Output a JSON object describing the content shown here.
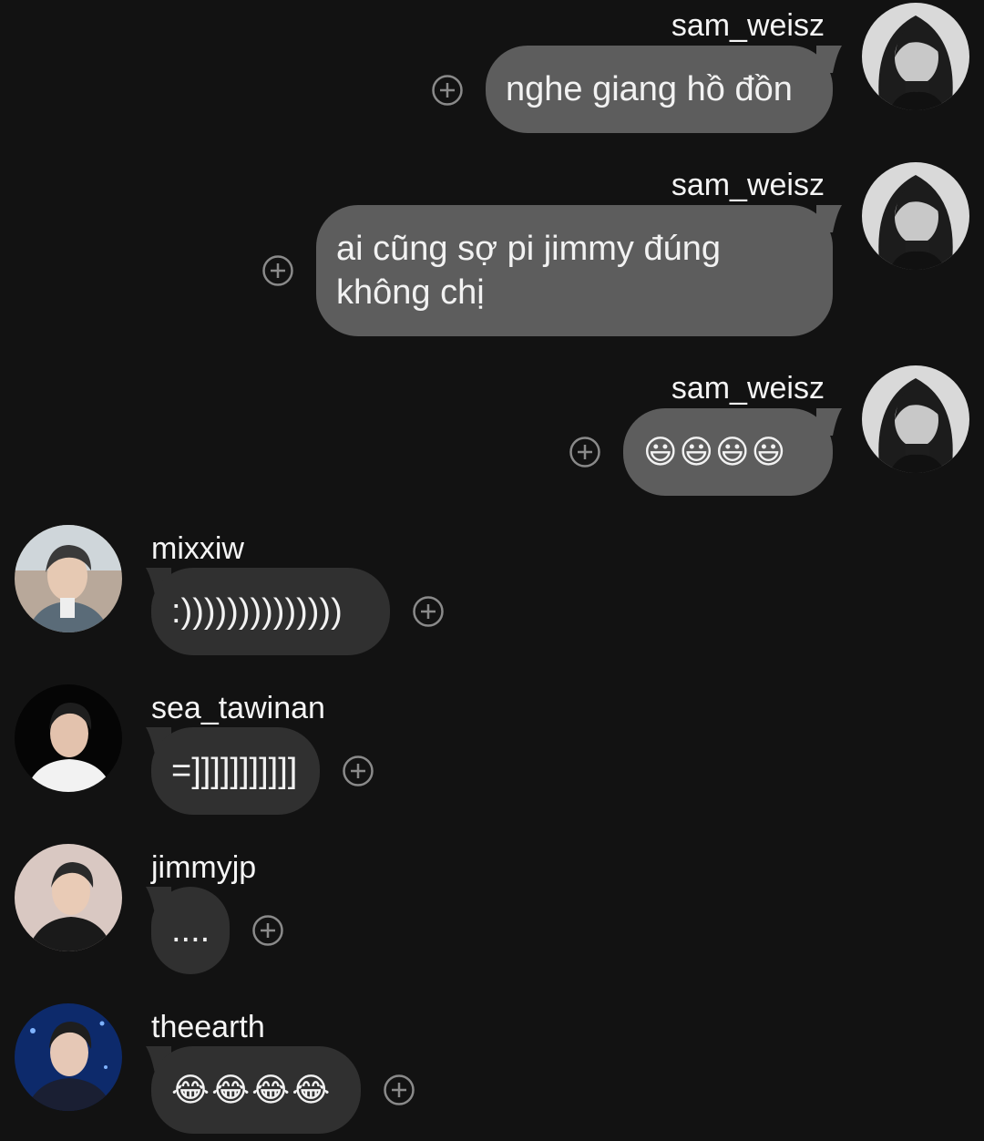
{
  "messages": [
    {
      "id": "m1",
      "sender": "sam_weisz",
      "text": "nghe giang hồ đồn",
      "direction": "outgoing",
      "avatar": "woman-portrait-bw"
    },
    {
      "id": "m2",
      "sender": "sam_weisz",
      "text": "ai cũng sợ pi jimmy đúng\nkhông chị",
      "direction": "outgoing",
      "avatar": "woman-portrait-bw"
    },
    {
      "id": "m3",
      "sender": "sam_weisz",
      "text": "😃😃😃😃",
      "direction": "outgoing",
      "avatar": "woman-portrait-bw"
    },
    {
      "id": "m4",
      "sender": "mixxiw",
      "text": ":))))))))))))))",
      "direction": "incoming",
      "avatar": "man-portrait-outdoor"
    },
    {
      "id": "m5",
      "sender": "sea_tawinan",
      "text": "=]]]]]]]]]]]",
      "direction": "incoming",
      "avatar": "man-portrait-white-shirt"
    },
    {
      "id": "m6",
      "sender": "jimmyjp",
      "text": "....",
      "direction": "incoming",
      "avatar": "man-portrait-dark-suit"
    },
    {
      "id": "m7",
      "sender": "theearth",
      "text": "😂😂😂😂",
      "direction": "incoming",
      "avatar": "man-portrait-blue-stage"
    }
  ],
  "icons": {
    "react": "add-reaction-icon"
  },
  "colors": {
    "background": "#121212",
    "outgoing_bubble": "#5d5d5d",
    "incoming_bubble": "#303030",
    "text": "#f2f2f2",
    "icon_outline": "#8a8a8a"
  }
}
